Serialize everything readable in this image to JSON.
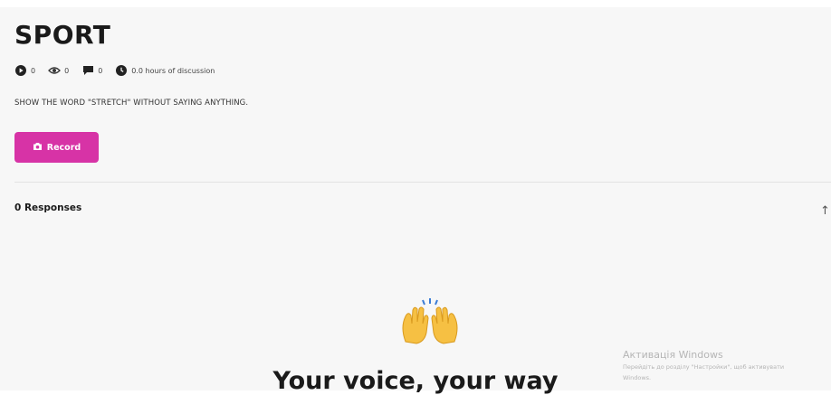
{
  "page": {
    "title": "SPORT",
    "prompt": "SHOW THE WORD \"STRETCH\" WITHOUT SAYING ANYTHING."
  },
  "stats": {
    "plays": "0",
    "views": "0",
    "comments": "0",
    "discussion": "0.0 hours of discussion"
  },
  "record_button": {
    "label": "Record"
  },
  "responses": {
    "label": "0 Responses"
  },
  "empty_state": {
    "title": "Your voice, your way"
  },
  "watermark": {
    "title": "Активація Windows",
    "line1": "Перейдіть до розділу \"Настройки\", щоб активувати",
    "line2": "Windows."
  },
  "icons": [
    "play-icon",
    "eye-icon",
    "comment-icon",
    "clock-icon",
    "camera-icon",
    "sort-icon",
    "raising-hands-icon"
  ],
  "colors": {
    "accent": "#d733a6",
    "panel": "#f7f7f7"
  }
}
